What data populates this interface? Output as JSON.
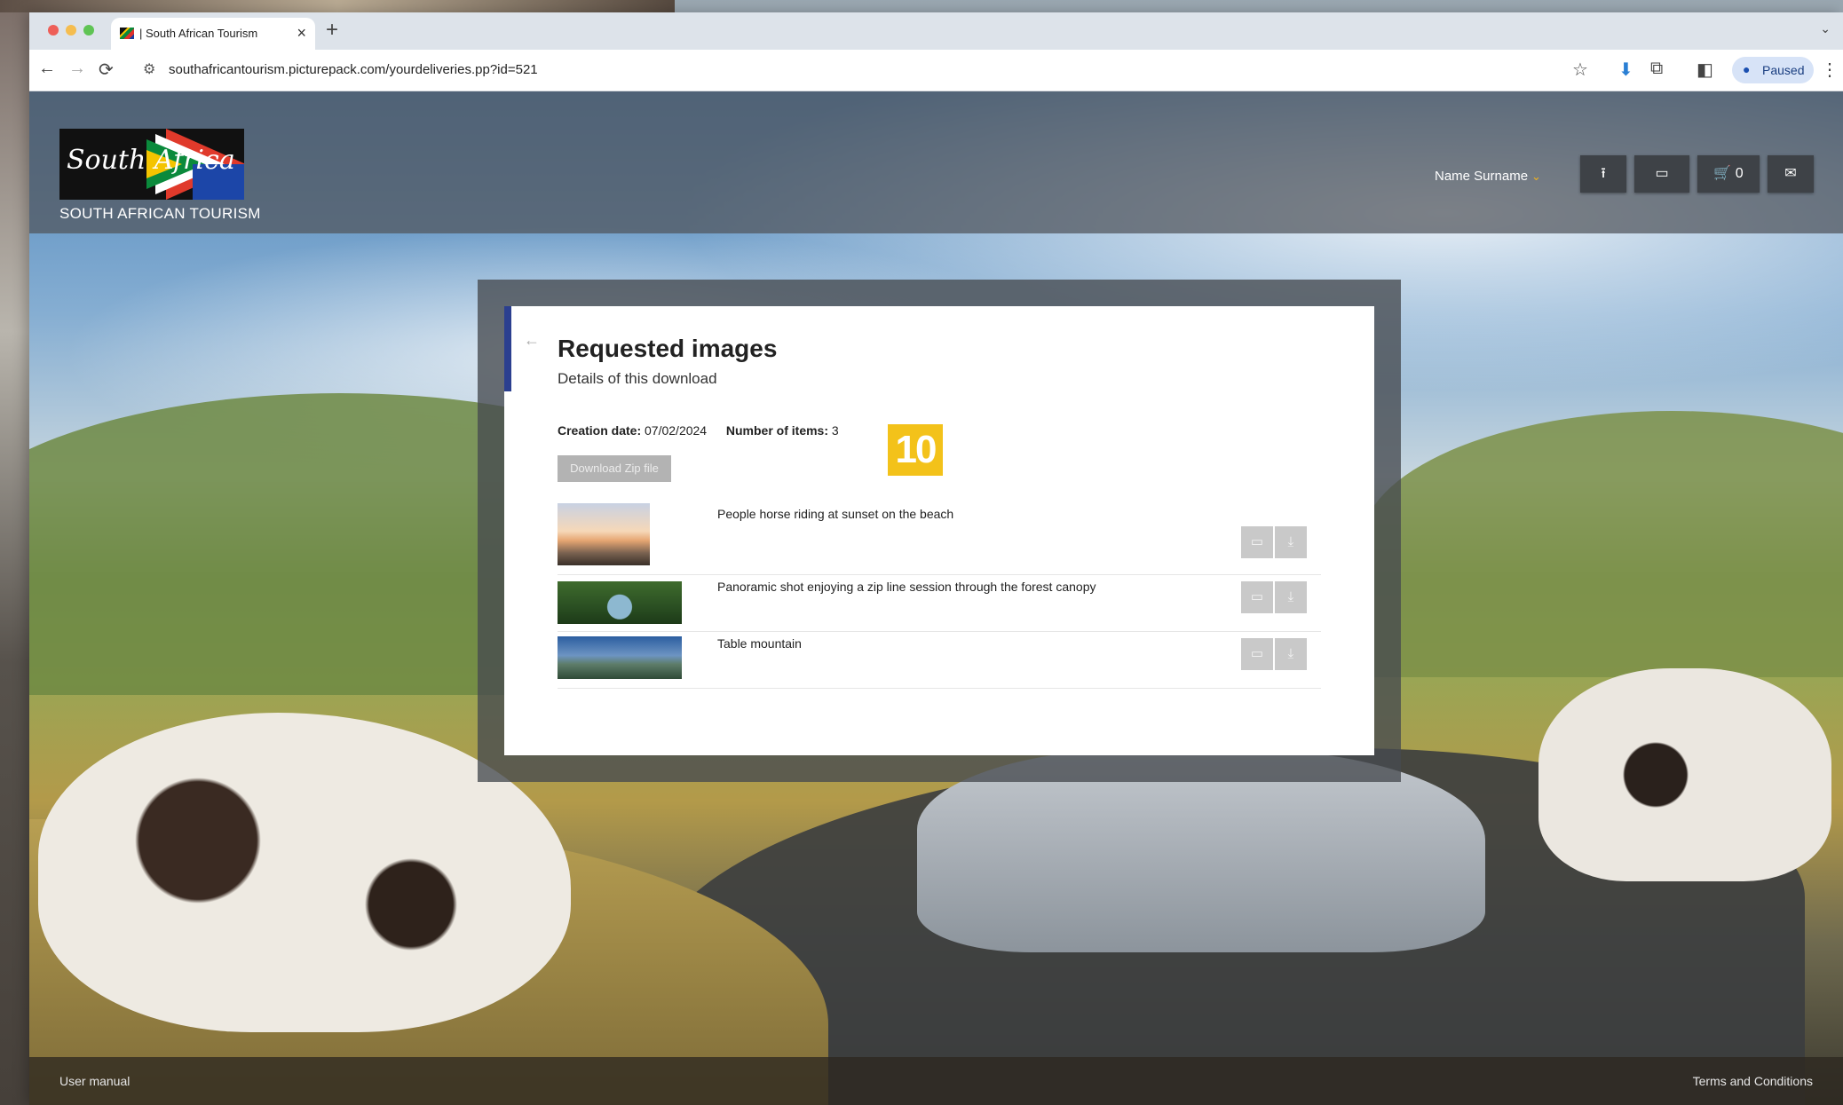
{
  "browser": {
    "tab_title": "| South African Tourism",
    "tab_close": "×",
    "new_tab": "+",
    "tab_dropdown": "⌄",
    "url": "southafricantourism.picturepack.com/yourdeliveries.pp?id=521",
    "profile_label": "Paused",
    "icons": {
      "back": "←",
      "forward": "→",
      "reload": "⟳",
      "site_info": "⚙",
      "star": "☆",
      "extension": "⬇",
      "puzzle": "⧉",
      "side_panel": "◧",
      "profile": "●",
      "menu": "⋮"
    }
  },
  "header": {
    "logo_text": "South Africa",
    "logo_caption": "SOUTH AFRICAN TOURISM",
    "user_name": "Name Surname",
    "user_chevron": "⌄",
    "buttons": {
      "upload": "⭱",
      "preview": "▭",
      "cart_icon": "🛒",
      "cart_count": "0",
      "mail": "✉"
    }
  },
  "modal": {
    "back_arrow": "←",
    "title": "Requested images",
    "subtitle": "Details of this download",
    "creation_date_label": "Creation date:",
    "creation_date_value": "07/02/2024",
    "items_label": "Number of items:",
    "items_value": "3",
    "download_zip_label": "Download Zip file",
    "items": [
      {
        "title": "People horse riding at sunset on the beach"
      },
      {
        "title": "Panoramic shot enjoying a zip line session through the forest canopy"
      },
      {
        "title": "Table mountain"
      }
    ],
    "action_icons": {
      "preview": "▭",
      "download": "⤓"
    }
  },
  "annotation": {
    "badge_number": "10"
  },
  "footer": {
    "left_link": "User manual",
    "right_link": "Terms and Conditions"
  },
  "colors": {
    "accent_blue": "#2b3f8f",
    "badge_yellow": "#f3c21a",
    "user_chevron": "#f2b21b"
  }
}
